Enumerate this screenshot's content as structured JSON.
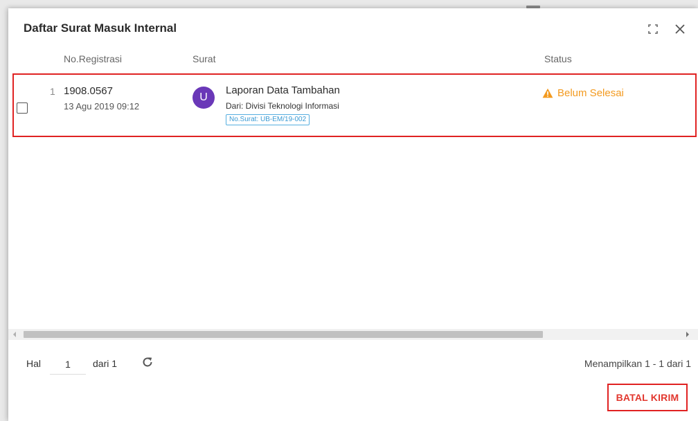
{
  "dialog": {
    "title": "Daftar Surat Masuk Internal",
    "expand_icon": "expand-icon",
    "close_icon": "close-icon"
  },
  "table": {
    "columns": {
      "noreg": "No.Registrasi",
      "surat": "Surat",
      "status": "Status"
    },
    "rows": [
      {
        "index": "1",
        "reg_no": "1908.0567",
        "reg_date": "13 Agu 2019 09:12",
        "avatar_letter": "U",
        "avatar_color": "#6a38b8",
        "subject": "Laporan Data Tambahan",
        "sender": "Dari: Divisi Teknologi Informasi",
        "letter_no": "No.Surat: UB-EM/19-002",
        "status": "Belum Selesai",
        "status_icon": "warning-icon",
        "status_color": "#f39a1f",
        "checked": false
      }
    ]
  },
  "pager": {
    "hal_label": "Hal",
    "page_value": "1",
    "dari_label": "dari 1",
    "refresh_icon": "refresh-icon",
    "showing": "Menampilkan 1 - 1 dari 1"
  },
  "footer": {
    "cancel_label": "BATAL KIRIM"
  },
  "colors": {
    "highlight_border": "#e02222",
    "cancel_text": "#e2372e",
    "tag_border": "#55aee0"
  }
}
